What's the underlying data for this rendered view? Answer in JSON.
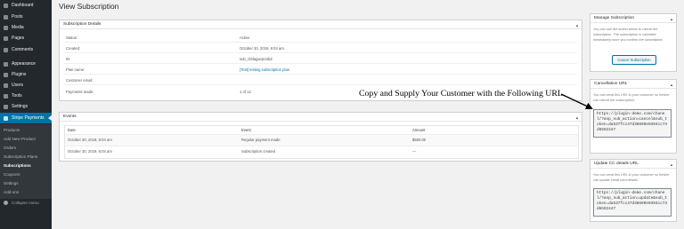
{
  "sidebar": {
    "menu": [
      {
        "label": "Dashboard",
        "icon": "dashboard-icon"
      },
      {
        "label": "Posts",
        "icon": "pin-icon"
      },
      {
        "label": "Media",
        "icon": "media-icon"
      },
      {
        "label": "Pages",
        "icon": "page-icon"
      },
      {
        "label": "Comments",
        "icon": "comment-icon"
      },
      {
        "label": "Appearance",
        "icon": "brush-icon"
      },
      {
        "label": "Plugins",
        "icon": "plug-icon"
      },
      {
        "label": "Users",
        "icon": "user-icon"
      },
      {
        "label": "Tools",
        "icon": "wrench-icon"
      },
      {
        "label": "Settings",
        "icon": "settings-icon"
      },
      {
        "label": "Stripe Payments",
        "icon": "stripe-icon"
      }
    ],
    "submenu": [
      "Products",
      "Add New Product",
      "Orders",
      "Subscription Plans",
      "Subscriptions",
      "Coupons",
      "Settings",
      "Add-ons"
    ],
    "current_submenu": "Subscriptions",
    "collapse_label": "Collapse menu"
  },
  "page": {
    "title": "View Subscription"
  },
  "details": {
    "heading": "Subscription Details",
    "rows": [
      {
        "label": "Status:",
        "value": "Active"
      },
      {
        "label": "Created:",
        "value": "October 30, 2019, 6:04 am"
      },
      {
        "label": "ID:",
        "value": "sub_G5fagwqronbZ"
      },
      {
        "label": "Plan name:",
        "value": "[Test] testing subscription plan"
      },
      {
        "label": "Customer email:",
        "value": ""
      },
      {
        "label": "Payments made:",
        "value": "1 of 12"
      }
    ]
  },
  "events": {
    "heading": "Events",
    "columns": [
      "Date",
      "Event",
      "Amount"
    ],
    "rows": [
      [
        "October 30, 2019, 6:04 am",
        "Regular payment made",
        "$550.00"
      ],
      [
        "October 30, 2019, 6:04 am",
        "Subscription created",
        "—"
      ]
    ]
  },
  "manage": {
    "heading": "Manage Subscription",
    "text": "You can use the button below to cancel the subscription. The subscription is canceled immediately once you confirm the cancellation.",
    "button": "Cancel Subscription"
  },
  "cancellation": {
    "heading": "Cancellation URL",
    "text": "You can send this URL to your customer so he/she can cancel the subscription.",
    "url": "https://plugin-demo.com/chanel/?asp_sub_action=cancel&sub_token=da537fcc47d38690e0394cc73d6592447"
  },
  "update_cc": {
    "heading": "Update CC details URL",
    "text": "You can send this URL to your customer so he/she can update credit card details.",
    "url": "https://plugin-demo.com/chanel/?asp_sub_action=update&sub_token=da537fcc47d38690e0394cc73d6592447"
  },
  "annotation": "Copy and Supply Your Customer with the Following URL",
  "colors": {
    "sidebar": "#23282d",
    "active": "#0073aa",
    "link": "#0073aa"
  }
}
